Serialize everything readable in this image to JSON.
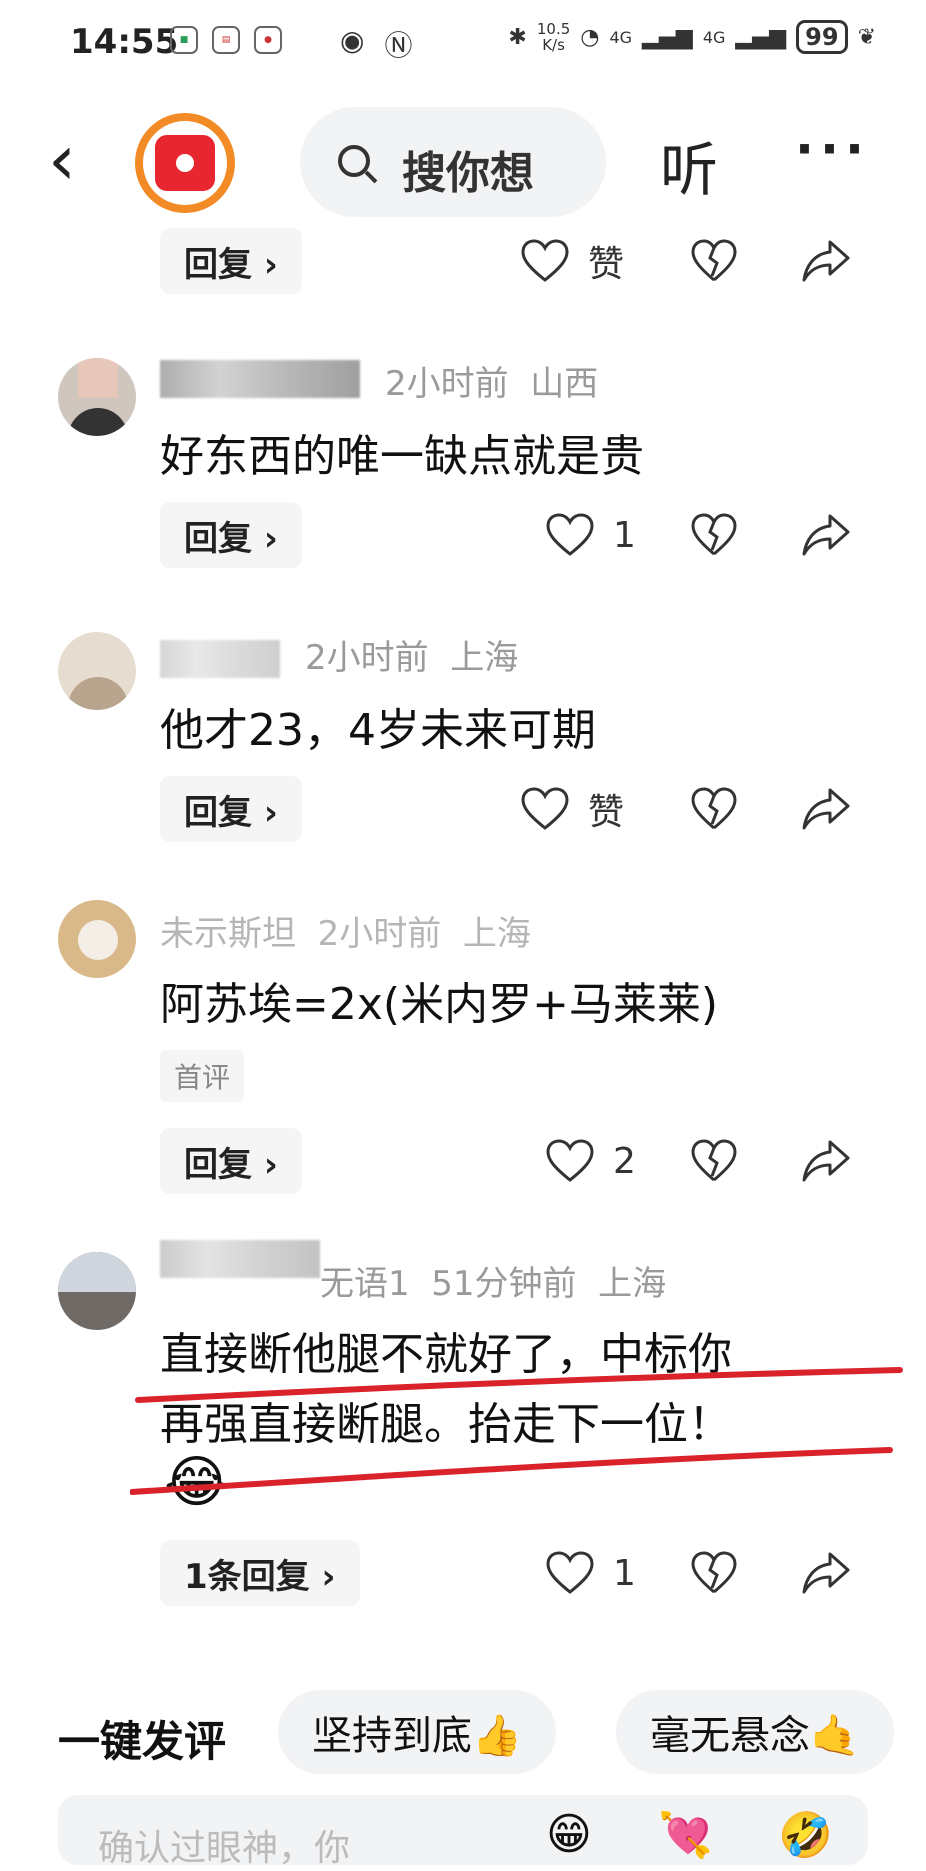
{
  "status_bar": {
    "time": "14:55",
    "net_speed_value": "10.5",
    "net_speed_unit": "K/s",
    "signal_labels": [
      "4G",
      "4G"
    ],
    "battery": "99"
  },
  "header": {
    "back_icon": "chevron-left-icon",
    "search_placeholder": "搜你想",
    "listen_label": "听",
    "more_label": "···"
  },
  "comments": [
    {
      "id": "c0",
      "reply_label": "回复 ›",
      "like_label": "赞"
    },
    {
      "id": "c1",
      "time": "2小时前",
      "location": "山西",
      "text": "好东西的唯一缺点就是贵",
      "reply_label": "回复 ›",
      "like_label": "1"
    },
    {
      "id": "c2",
      "time": "2小时前",
      "location": "上海",
      "text": "他才23，4岁未来可期",
      "reply_label": "回复 ›",
      "like_label": "赞"
    },
    {
      "id": "c3",
      "name_partial": "未示斯坦",
      "time": "2小时前",
      "location": "上海",
      "text": "阿苏埃=2x(米内罗+马莱莱)",
      "tag": "首评",
      "reply_label": "回复 ›",
      "like_label": "2"
    },
    {
      "id": "c4",
      "name_partial": "无语1",
      "time": "51分钟前",
      "location": "上海",
      "text_line1": "直接断他腿不就好了，中标你",
      "text_line2": "再强直接断腿。抬走下一位！",
      "emoji": "😂",
      "reply_label": "1条回复 ›",
      "like_label": "1"
    }
  ],
  "quick_comment": {
    "label": "一键发评",
    "chips": [
      "坚持到底👍",
      "毫无悬念🤙"
    ]
  },
  "input_bar": {
    "placeholder": "确认过眼神，你",
    "emojis": [
      "😁",
      "💘",
      "🤣"
    ]
  },
  "colors": {
    "accent_orange": "#f28a25",
    "brand_red": "#e8262f",
    "annotation_red": "#d9222a",
    "meta_gray": "#9a9a9a"
  }
}
